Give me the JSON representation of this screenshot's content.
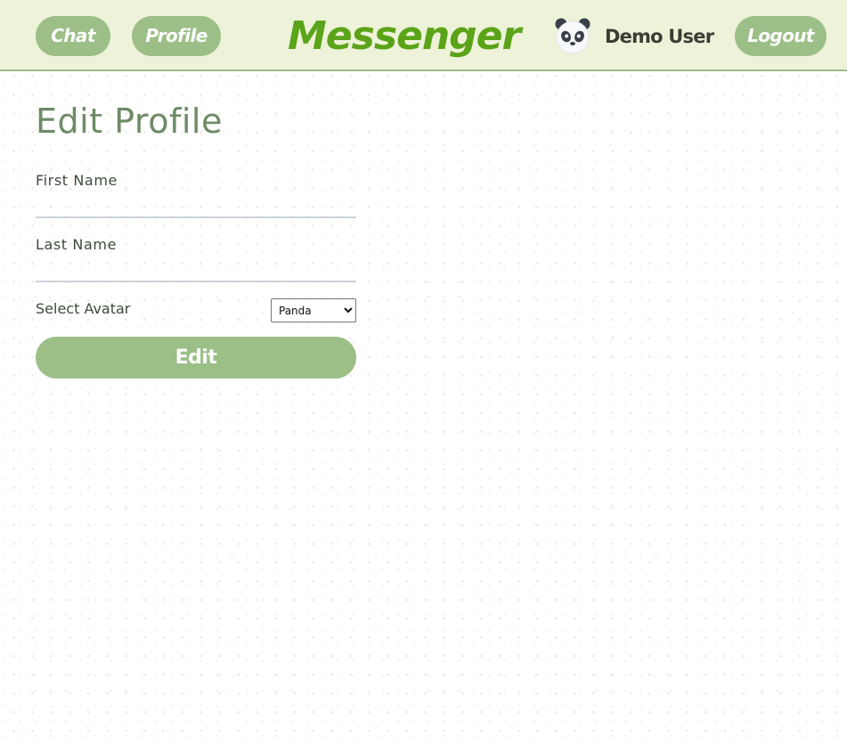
{
  "header": {
    "app_title": "Messenger",
    "nav": {
      "chat_label": "Chat",
      "profile_label": "Profile"
    },
    "user": {
      "name": "Demo User",
      "avatar_icon": "panda-avatar-icon"
    },
    "logout_label": "Logout"
  },
  "form": {
    "title": "Edit Profile",
    "first_name": {
      "label": "First Name",
      "value": ""
    },
    "last_name": {
      "label": "Last Name",
      "value": ""
    },
    "avatar": {
      "label": "Select Avatar",
      "selected": "Panda"
    },
    "submit_label": "Edit"
  },
  "colors": {
    "header_bg": "#eef2d9",
    "accent_green": "#9bbf87",
    "brand_green": "#5ba419",
    "title_green": "#6e8b66"
  }
}
